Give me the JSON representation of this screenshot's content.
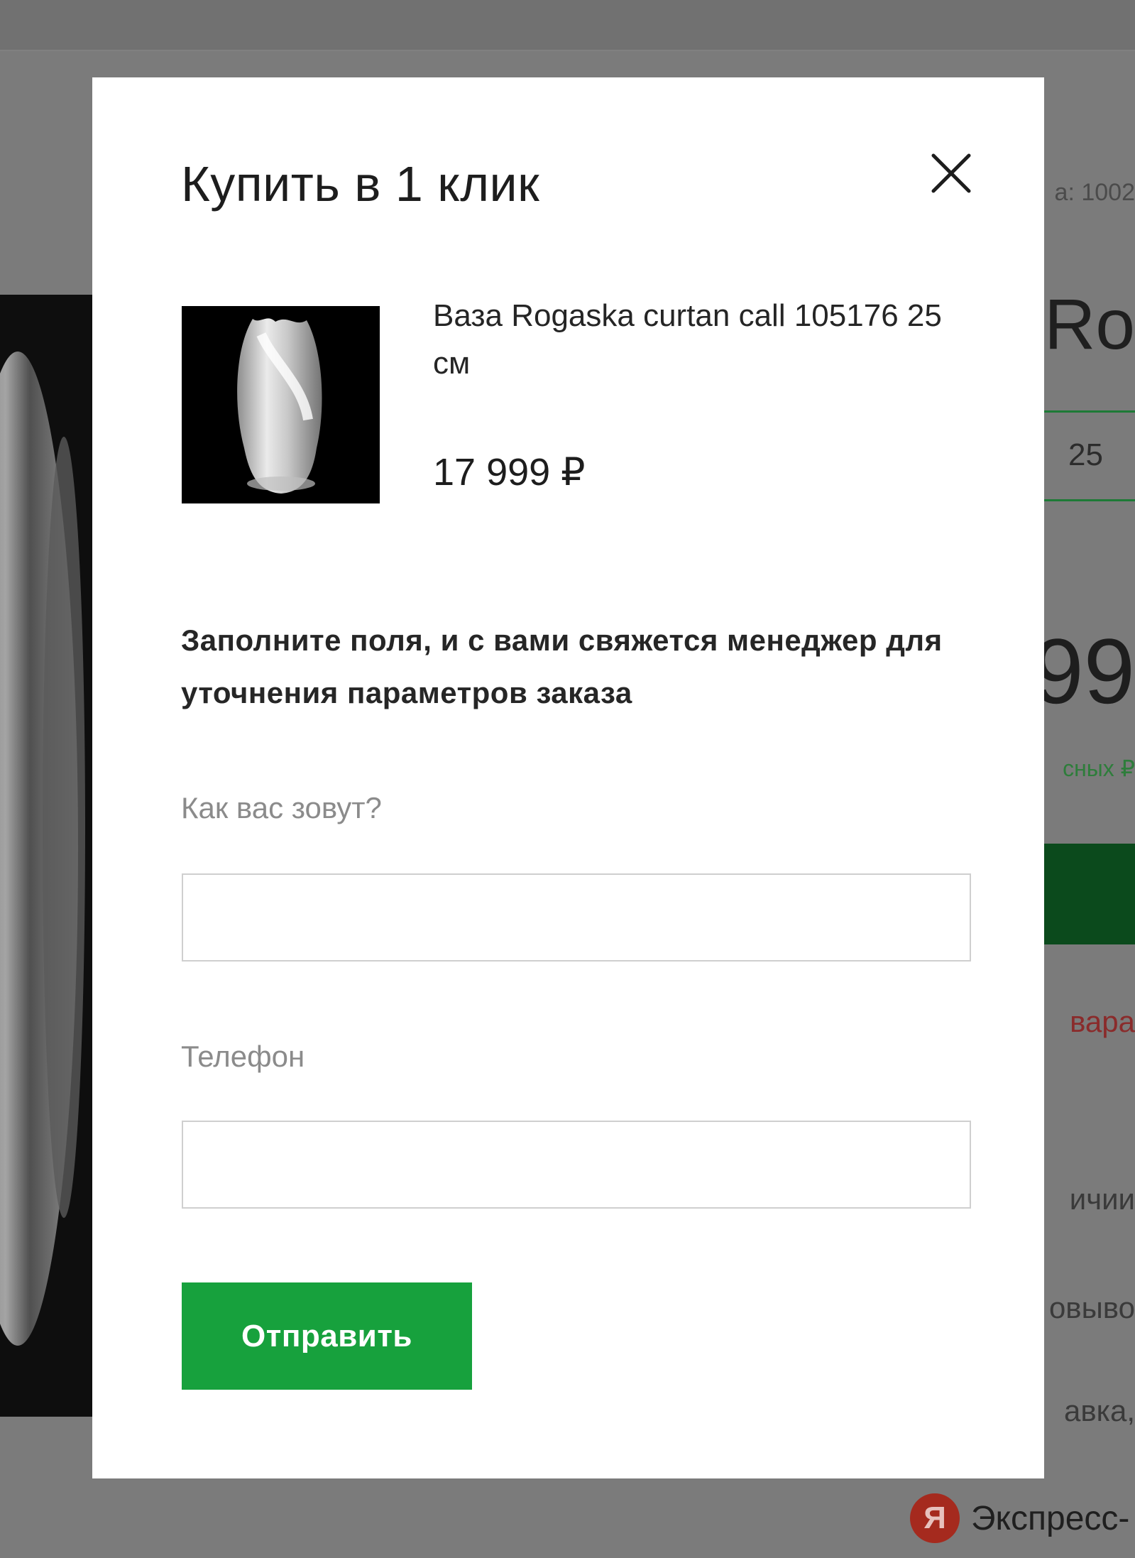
{
  "background": {
    "sku_fragment": "а: 1002",
    "title_fragment": "a Ro",
    "size_value": "25",
    "price_fragment": "99",
    "bonus_fragment": "сных ₽",
    "status_fragment": "вара",
    "availability_fragment": "ичии",
    "pickup_fragment": "овыво",
    "delivery_fragment": "авка,",
    "express": {
      "logo_letter": "Я",
      "label": "Экспресс-"
    }
  },
  "modal": {
    "title": "Купить в 1 клик",
    "close_icon": "close-icon",
    "product": {
      "name": "Ваза Rogaska curtan call 105176 25 см",
      "price": "17 999 ₽"
    },
    "instructions": "Заполните поля, и с вами свяжется менеджер для уточнения параметров заказа",
    "form": {
      "name_label": "Как вас зовут?",
      "name_value": "",
      "phone_label": "Телефон",
      "phone_value": "",
      "submit_label": "Отправить"
    }
  },
  "colors": {
    "overlay": "#7b7b7b",
    "modal_bg": "#ffffff",
    "accent_green": "#17a13d",
    "label_gray": "#8b8b8b",
    "input_border": "#cfcfcf"
  }
}
